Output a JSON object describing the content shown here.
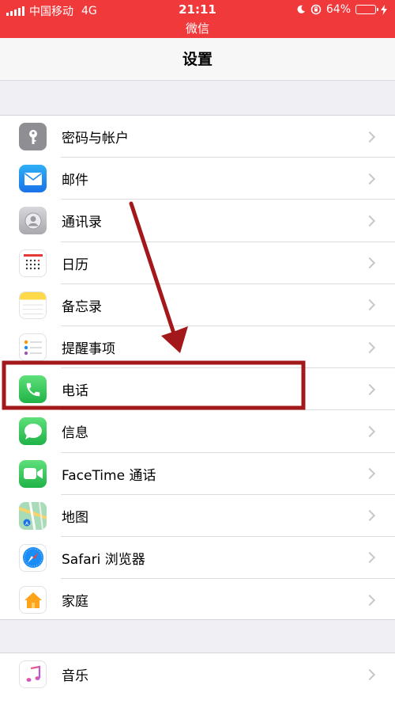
{
  "status_bar": {
    "carrier": "中国移动",
    "network": "4G",
    "time": "21:11",
    "sub_title": "微信",
    "battery": "64%",
    "battery_level": 0.64,
    "bg_color": "#f0393b"
  },
  "nav": {
    "title": "设置"
  },
  "settings_group_1": [
    {
      "label": "密码与帐户",
      "icon": "key-icon",
      "color": "#8e8e93"
    },
    {
      "label": "邮件",
      "icon": "mail-icon",
      "color": "#1a8cf5"
    },
    {
      "label": "通讯录",
      "icon": "contacts-icon",
      "color": "#b9b9bd"
    },
    {
      "label": "日历",
      "icon": "calendar-icon",
      "color": "#ffffff"
    },
    {
      "label": "备忘录",
      "icon": "notes-icon",
      "color": "#ffd94a"
    },
    {
      "label": "提醒事项",
      "icon": "reminders-icon",
      "color": "#ffffff"
    },
    {
      "label": "电话",
      "icon": "phone-icon",
      "color": "#34c759"
    },
    {
      "label": "信息",
      "icon": "messages-icon",
      "color": "#34c759"
    },
    {
      "label": "FaceTime 通话",
      "icon": "facetime-icon",
      "color": "#34c759"
    },
    {
      "label": "地图",
      "icon": "maps-icon",
      "color": "#7fc8a0"
    },
    {
      "label": "Safari 浏览器",
      "icon": "safari-icon",
      "color": "#ffffff"
    },
    {
      "label": "家庭",
      "icon": "home-icon",
      "color": "#ffffff"
    }
  ],
  "settings_group_2": [
    {
      "label": "音乐",
      "icon": "music-icon",
      "color": "#ffffff"
    }
  ],
  "annotation": {
    "highlight_color": "#a3191b",
    "highlighted_item": "电话"
  }
}
